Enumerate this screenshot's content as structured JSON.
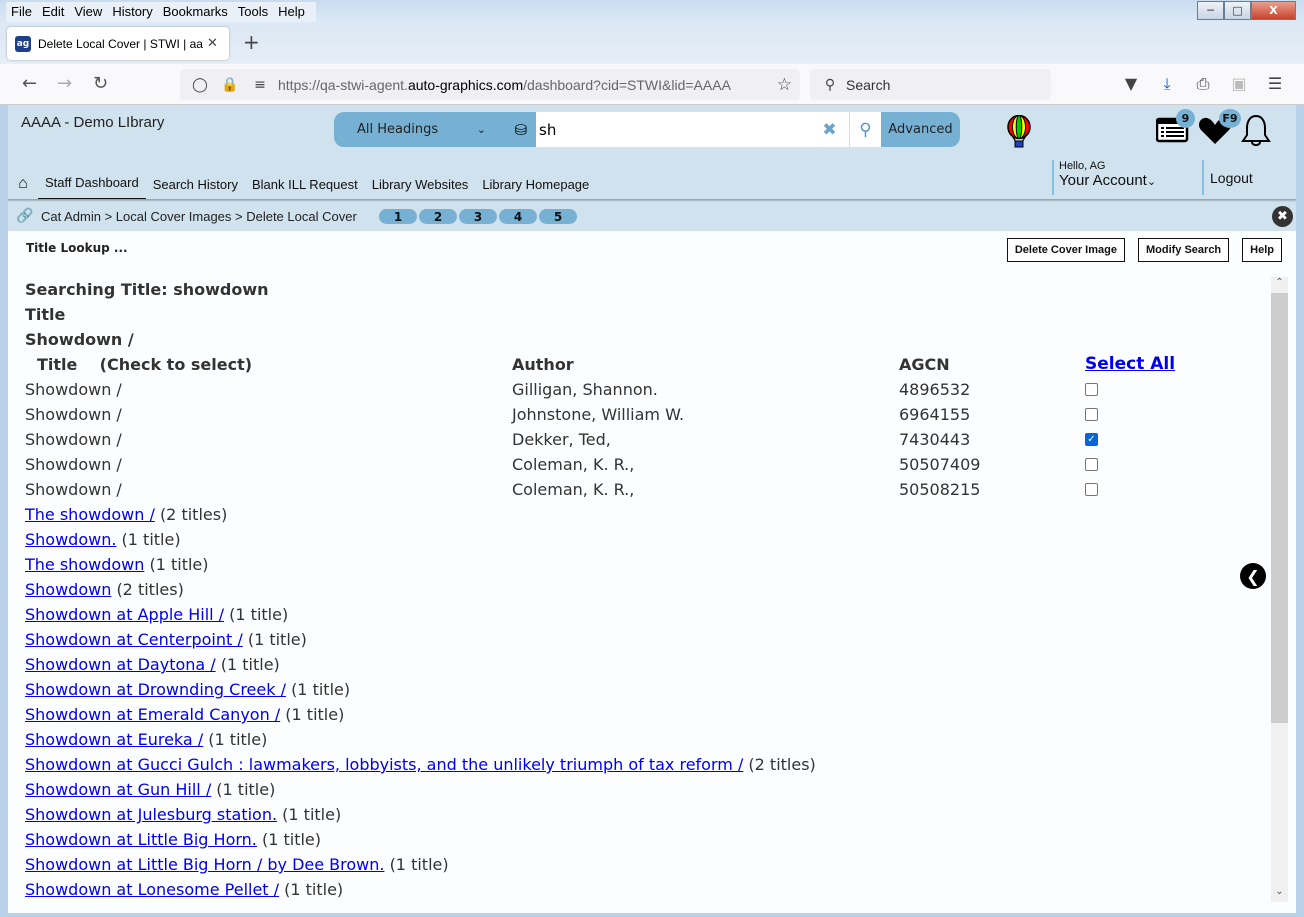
{
  "browser": {
    "menu": [
      "File",
      "Edit",
      "View",
      "History",
      "Bookmarks",
      "Tools",
      "Help"
    ],
    "tab_title": "Delete Local Cover | STWI | aaaa",
    "url_prefix": "https://qa-stwi-agent.",
    "url_domain": "auto-graphics.com",
    "url_path": "/dashboard?cid=STWI&lid=AAAA",
    "search_placeholder": "Search"
  },
  "header": {
    "library_name": "AAAA - Demo LIbrary",
    "heading_select": "All Headings",
    "search_value": "sh",
    "advanced_label": "Advanced",
    "list_badge": "9",
    "fav_badge": "F9",
    "nav": [
      "Staff Dashboard",
      "Search History",
      "Blank ILL Request",
      "Library Websites",
      "Library Homepage"
    ],
    "hello": "Hello, AG",
    "account": "Your Account",
    "logout": "Logout"
  },
  "breadcrumb": {
    "path": "Cat Admin > Local Cover Images > Delete Local Cover",
    "steps": [
      "1",
      "2",
      "3",
      "4",
      "5"
    ]
  },
  "main": {
    "lookup_title": "Title Lookup ...",
    "buttons": {
      "delete": "Delete Cover Image",
      "modify": "Modify Search",
      "help": "Help"
    },
    "searching": "Searching Title: showdown",
    "section_label": "Title",
    "group_title": "Showdown /",
    "columns": {
      "title": "Title",
      "check_hint": "(Check to select)",
      "author": "Author",
      "agcn": "AGCN",
      "select_all": "Select All"
    },
    "rows": [
      {
        "title": "Showdown /",
        "author": "Gilligan, Shannon.",
        "agcn": "4896532",
        "checked": false
      },
      {
        "title": "Showdown /",
        "author": "Johnstone, William W.",
        "agcn": "6964155",
        "checked": false
      },
      {
        "title": "Showdown /",
        "author": "Dekker, Ted,",
        "agcn": "7430443",
        "checked": true
      },
      {
        "title": "Showdown /",
        "author": "Coleman, K. R.,",
        "agcn": "50507409",
        "checked": false
      },
      {
        "title": "Showdown /",
        "author": "Coleman, K. R.,",
        "agcn": "50508215",
        "checked": false
      }
    ],
    "headings": [
      {
        "text": "The showdown /",
        "count": "(2 titles)"
      },
      {
        "text": "Showdown.",
        "count": "(1 title)"
      },
      {
        "text": "The showdown",
        "count": "(1 title)"
      },
      {
        "text": "Showdown",
        "count": "(2 titles)"
      },
      {
        "text": "Showdown at Apple Hill /",
        "count": "(1 title)"
      },
      {
        "text": "Showdown at Centerpoint /",
        "count": "(1 title)"
      },
      {
        "text": "Showdown at Daytona /",
        "count": "(1 title)"
      },
      {
        "text": "Showdown at Drownding Creek /",
        "count": "(1 title)"
      },
      {
        "text": "Showdown at Emerald Canyon /",
        "count": "(1 title)"
      },
      {
        "text": "Showdown at Eureka /",
        "count": "(1 title)"
      },
      {
        "text": "Showdown at Gucci Gulch : lawmakers, lobbyists, and the unlikely triumph of tax reform /",
        "count": "(2 titles)"
      },
      {
        "text": "Showdown at Gun Hill /",
        "count": "(1 title)"
      },
      {
        "text": "Showdown at Julesburg station.",
        "count": "(1 title)"
      },
      {
        "text": "Showdown at Little Big Horn.",
        "count": "(1 title)"
      },
      {
        "text": "Showdown at Little Big Horn / by Dee Brown.",
        "count": "(1 title)"
      },
      {
        "text": "Showdown at Lonesome Pellet /",
        "count": "(1 title)"
      }
    ]
  }
}
